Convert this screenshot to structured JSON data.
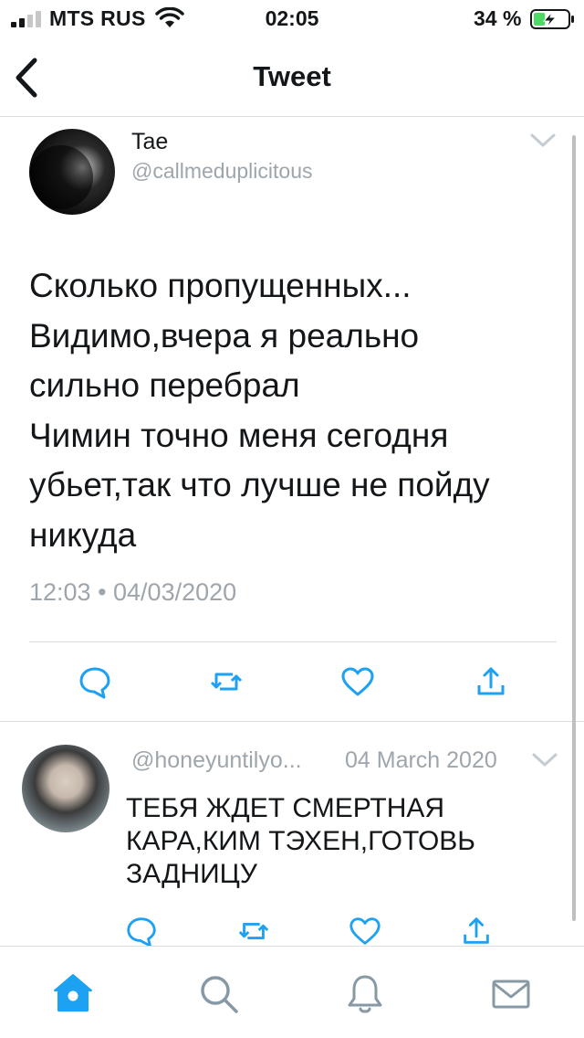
{
  "status_bar": {
    "carrier": "MTS RUS",
    "time": "02:05",
    "battery_percent": "34 %",
    "battery_level": 0.34
  },
  "nav": {
    "title": "Tweet",
    "back_icon": "chevron-left-icon"
  },
  "tweet": {
    "author_name": "Tae",
    "author_handle": "@callmeduplicitous",
    "text": "Сколько пропущенных...\nВидимо,вчера я реально\nсильно перебрал\nЧимин точно меня сегодня\nубьет,так что лучше не пойду\nникуда",
    "meta": "12:03 • 04/03/2020",
    "actions": [
      "reply-icon",
      "retweet-icon",
      "like-icon",
      "share-icon"
    ]
  },
  "reply": {
    "author_handle": "@honeyuntilyo...",
    "date": "04 March 2020",
    "text": "ТЕБЯ ЖДЕТ СМЕРТНАЯ\nКАРА,КИМ ТЭХЕН,ГОТОВЬ\nЗАДНИЦУ",
    "actions": [
      "reply-icon",
      "retweet-icon",
      "like-icon",
      "share-icon"
    ]
  },
  "tab_bar": {
    "items": [
      "home-icon",
      "search-icon",
      "notifications-icon",
      "messages-icon"
    ],
    "active": "home-icon",
    "active_color": "#1da1f2",
    "inactive_color": "#8899a6"
  },
  "colors": {
    "text": "#14171a",
    "secondary_text": "#9ea6ad",
    "action_icon": "#1da1f2",
    "battery_fill": "#4cd964"
  }
}
